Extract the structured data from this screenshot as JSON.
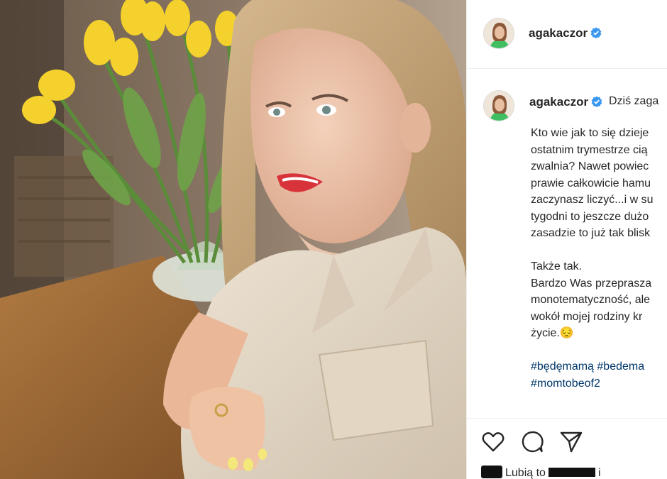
{
  "post": {
    "username": "agakaczor",
    "caption_inline": "Dziś zaga",
    "caption_lines": [
      "Kto wie jak to się dzieje",
      "ostatnim trymestrze cią",
      "zwalnia? Nawet powiec",
      "prawie całkowicie hamu",
      "zaczynasz liczyć...i w su",
      "tygodni to jeszcze dużo",
      "zasadzie to już tak blisk",
      "",
      "Także tak.",
      "Bardzo Was przeprasza",
      "monotematyczność, ale",
      "wokół mojej rodziny kr",
      "życie.😔"
    ],
    "hashtags": [
      "#będęmamą #bedema",
      "#momtobeof2"
    ],
    "likes_prefix": "Lubią to",
    "likes_suffix": "i"
  },
  "icons": {
    "verified": "verified-badge-icon",
    "like": "heart-icon",
    "comment": "comment-icon",
    "share": "share-icon"
  },
  "colors": {
    "verified": "#3897f0",
    "text": "#262626",
    "hashtag": "#00376b"
  }
}
